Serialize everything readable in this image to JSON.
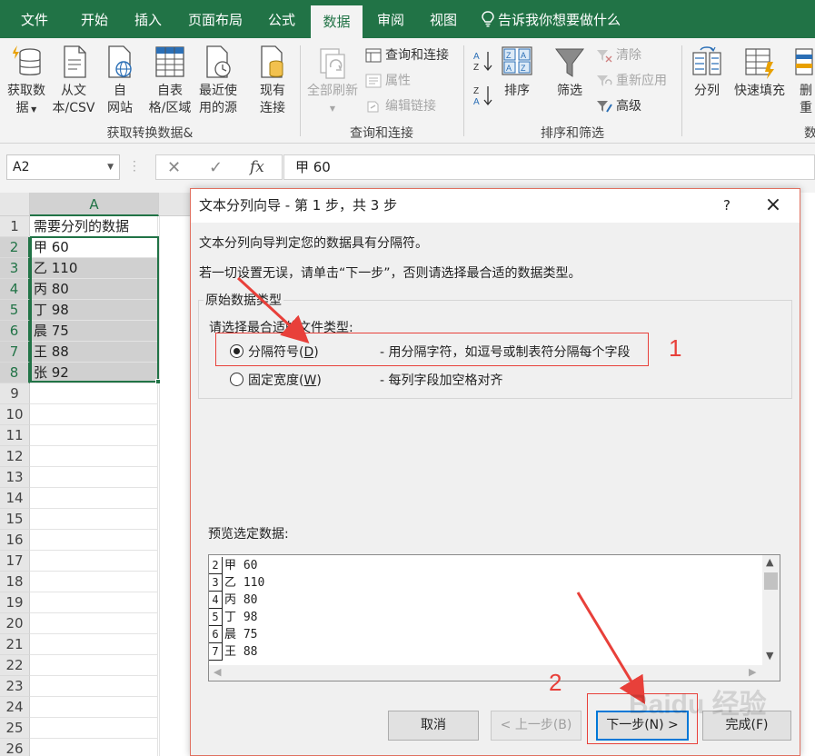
{
  "menu": {
    "tabs": [
      {
        "label": "文件"
      },
      {
        "label": "开始"
      },
      {
        "label": "插入"
      },
      {
        "label": "页面布局"
      },
      {
        "label": "公式"
      },
      {
        "label": "数据",
        "active": true
      },
      {
        "label": "审阅"
      },
      {
        "label": "视图"
      }
    ],
    "tell_me": "告诉我你想要做什么"
  },
  "ribbon": {
    "get_data": {
      "line1": "获取数",
      "line2": "据"
    },
    "from_text": {
      "line1": "从文",
      "line2": "本/CSV"
    },
    "from_web": {
      "line1": "自",
      "line2": "网站"
    },
    "from_table": {
      "line1": "自表",
      "line2": "格/区域"
    },
    "recent_sources": {
      "line1": "最近使",
      "line2": "用的源"
    },
    "existing_connections": {
      "line1": "现有",
      "line2": "连接"
    },
    "group1": "获取转换数据&",
    "refresh_all": "全部刷新",
    "queries_connections": "查询和连接",
    "properties": "属性",
    "edit_links": "编辑链接",
    "group2": "查询和连接",
    "sort": "排序",
    "filter": "筛选",
    "clear": "清除",
    "reapply": "重新应用",
    "advanced": "高级",
    "group3": "排序和筛选",
    "text_to_columns": "分列",
    "flash_fill": "快速填充",
    "remove_dup": {
      "line1": "删",
      "line2": "重"
    },
    "group4": "数"
  },
  "formula_bar": {
    "name_box": "A2",
    "fx": "fx",
    "content": "甲 60"
  },
  "sheet": {
    "column": "A",
    "rows": [
      "1",
      "2",
      "3",
      "4",
      "5",
      "6",
      "7",
      "8",
      "9",
      "10",
      "11",
      "12",
      "13",
      "14",
      "15",
      "16",
      "17",
      "18",
      "19",
      "20",
      "21",
      "22",
      "23",
      "24",
      "25",
      "26"
    ],
    "cells": [
      "需要分列的数据",
      "甲 60",
      "乙 110",
      "丙 80",
      "丁 98",
      "晨 75",
      "王 88",
      "张 92"
    ]
  },
  "dialog": {
    "title": "文本分列向导 - 第 1 步，共 3 步",
    "help": "?",
    "intro": "文本分列向导判定您的数据具有分隔符。",
    "instruction": "若一切设置无误，请单击“下一步”，否则请选择最合适的数据类型。",
    "group_title": "原始数据类型",
    "choose_label": "请选择最合适的文件类型:",
    "delimited": {
      "label": "分隔符号(",
      "key": "D",
      "suffix": ")",
      "desc": "- 用分隔字符，如逗号或制表符分隔每个字段"
    },
    "fixed_width": {
      "label": "固定宽度(",
      "key": "W",
      "suffix": ")",
      "desc": "- 每列字段加空格对齐"
    },
    "preview_label": "预览选定数据:",
    "preview_rows": [
      {
        "n": "2",
        "text": "甲 60"
      },
      {
        "n": "3",
        "text": "乙 110"
      },
      {
        "n": "4",
        "text": "丙 80"
      },
      {
        "n": "5",
        "text": "丁 98"
      },
      {
        "n": "6",
        "text": "晨 75"
      },
      {
        "n": "7",
        "text": "王 88"
      }
    ],
    "buttons": {
      "cancel": "取消",
      "back": "< 上一步(B)",
      "next": "下一步(N) >",
      "finish": "完成(F)"
    }
  },
  "annotations": {
    "one": "1",
    "two": "2"
  },
  "watermark": "Baidu 经验",
  "colors": {
    "excel_green": "#217346",
    "annotation_red": "#e8403a"
  }
}
